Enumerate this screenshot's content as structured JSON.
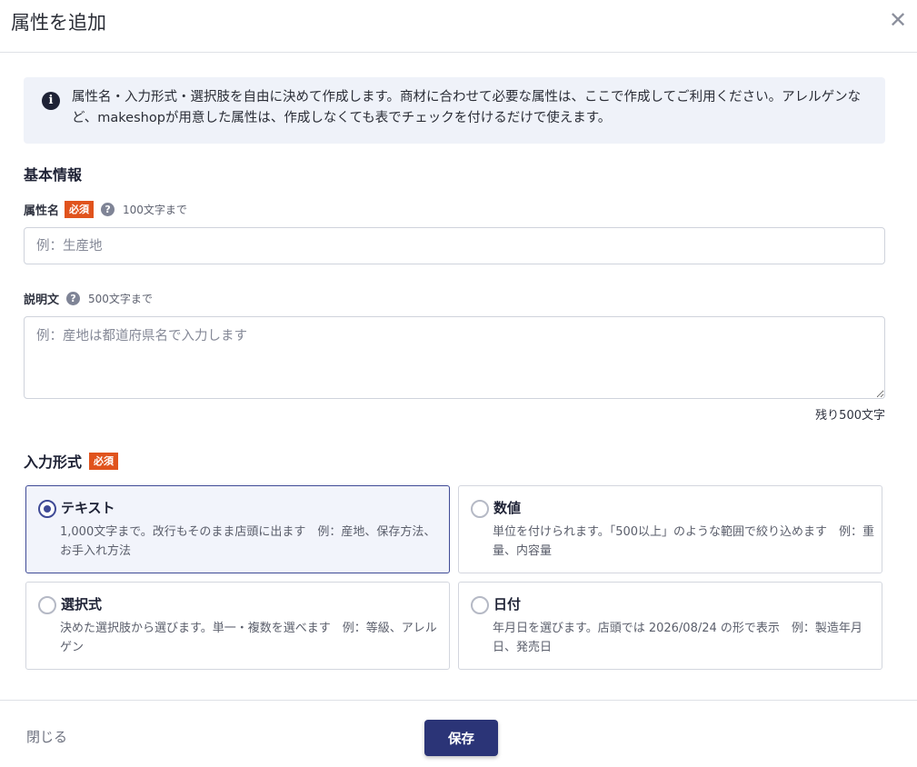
{
  "header": {
    "title": "属性を追加",
    "close_icon": "close-icon"
  },
  "info": {
    "icon": "info-icon",
    "text": "属性名・入力形式・選択肢を自由に決めて作成します。商材に合わせて必要な属性は、ここで作成してご利用ください。アレルゲンなど、makeshopが用意した属性は、作成しなくても表でチェックを付けるだけで使えます。"
  },
  "basic": {
    "title": "基本情報",
    "name_label": "属性名",
    "name_required": "必須",
    "name_limit": "100文字まで",
    "name_placeholder": "例：生産地",
    "name_value": "",
    "desc_label": "説明文",
    "desc_limit": "500文字まで",
    "desc_placeholder": "例：産地は都道府県名で入力します",
    "desc_value": "",
    "remaining": "残り500文字"
  },
  "input_type": {
    "title": "入力形式",
    "required": "必須",
    "selected": "text",
    "options": [
      {
        "key": "text",
        "title": "テキスト",
        "desc": "1,000文字まで。改行もそのまま店頭に出ます　例：産地、保存方法、お手入れ方法"
      },
      {
        "key": "number",
        "title": "数値",
        "desc": "単位を付けられます。「500以上」のような範囲で絞り込めます　例：重量、内容量"
      },
      {
        "key": "select",
        "title": "選択式",
        "desc": "決めた選択肢から選びます。単一・複数を選べます　例：等級、アレルゲン"
      },
      {
        "key": "date",
        "title": "日付",
        "desc": "年月日を選びます。店頭では 2026/08/24 の形で表示　例：製造年月日、発売日"
      }
    ]
  },
  "footer": {
    "close_label": "閉じる",
    "save_label": "保存"
  },
  "colors": {
    "primary": "#2b3477",
    "required_badge": "#e0531d",
    "info_bg": "#eff2f9",
    "selected_border": "#3f4a96"
  }
}
